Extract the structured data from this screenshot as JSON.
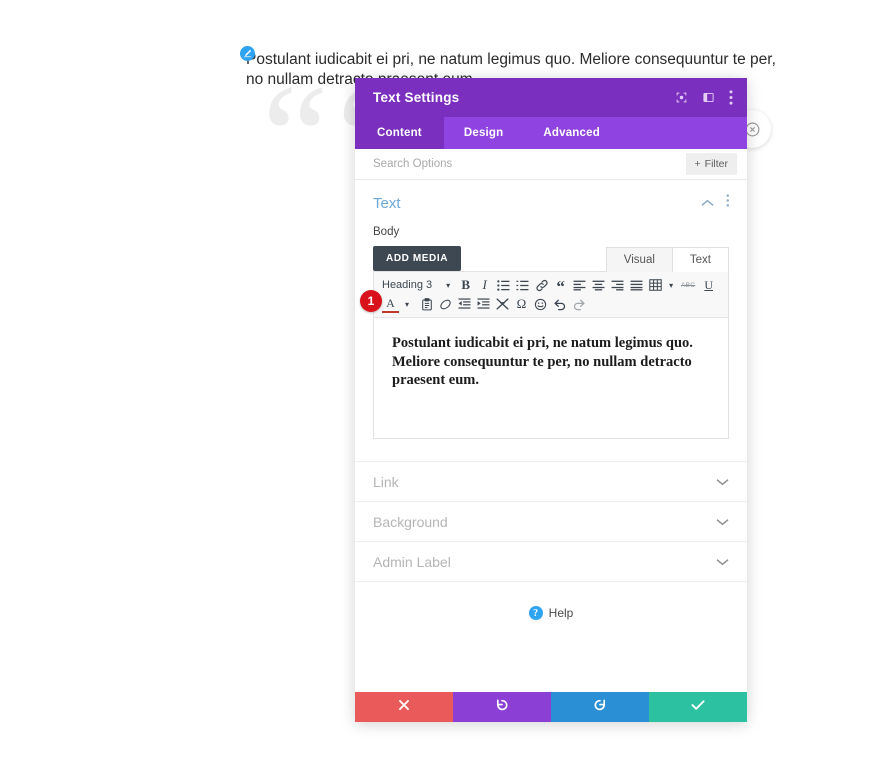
{
  "page": {
    "background_paragraph": "Postulant iudicabit ei pri, ne natum legimus quo. Meliore consequuntur te per, no nullam detracto praesent eum.",
    "quote_marks": "““",
    "edit_badge_icon": "pencil-icon",
    "floating_close_icon": "close-circle-icon"
  },
  "modal": {
    "title": "Text Settings",
    "header_icons": [
      {
        "name": "expand-icon",
        "title": "Expand"
      },
      {
        "name": "layout-toggle-icon",
        "title": "Layout"
      },
      {
        "name": "more-options-icon",
        "title": "More"
      }
    ],
    "tabs": [
      {
        "label": "Content",
        "active": true
      },
      {
        "label": "Design",
        "active": false
      },
      {
        "label": "Advanced",
        "active": false
      }
    ],
    "search": {
      "placeholder": "Search Options",
      "value": ""
    },
    "filter_label": "Filter",
    "filter_icon": "plus-icon",
    "section": {
      "title": "Text",
      "collapse_icon": "chevron-up-icon",
      "menu_icon": "more-options-icon",
      "field_label": "Body",
      "add_media_label": "ADD MEDIA",
      "editor_tabs": [
        {
          "label": "Visual",
          "active": true
        },
        {
          "label": "Text",
          "active": false
        }
      ]
    },
    "editor": {
      "format_select": "Heading 3",
      "toolbar_row1": [
        {
          "name": "bold-icon",
          "glyph": "B",
          "style": "bold-serif"
        },
        {
          "name": "italic-icon",
          "glyph": "I",
          "style": "italic-serif"
        },
        {
          "name": "bulleted-list-icon",
          "glyph": "☰",
          "style": "list"
        },
        {
          "name": "numbered-list-icon",
          "glyph": "☰",
          "style": "list"
        },
        {
          "name": "link-icon",
          "glyph": "🔗",
          "style": "icon"
        },
        {
          "name": "blockquote-icon",
          "glyph": "“",
          "style": "quote"
        },
        {
          "name": "align-left-icon",
          "glyph": "≡",
          "style": "align"
        },
        {
          "name": "align-center-icon",
          "glyph": "≡",
          "style": "align"
        },
        {
          "name": "align-right-icon",
          "glyph": "≡",
          "style": "align"
        },
        {
          "name": "align-justify-icon",
          "glyph": "≡",
          "style": "align"
        },
        {
          "name": "table-icon",
          "glyph": "▦",
          "style": "icon"
        },
        {
          "name": "table-caret-icon",
          "glyph": "▾",
          "style": "caret"
        },
        {
          "name": "strikethrough-icon",
          "glyph": "ABC",
          "style": "abc"
        },
        {
          "name": "underline-icon",
          "glyph": "U",
          "style": "underline"
        }
      ],
      "toolbar_row2": [
        {
          "name": "text-color-icon",
          "glyph": "A",
          "style": "colorA"
        },
        {
          "name": "text-color-caret-icon",
          "glyph": "▾",
          "style": "caret"
        },
        {
          "name": "paste-as-text-icon",
          "glyph": "📋",
          "style": "icon"
        },
        {
          "name": "clear-formatting-icon",
          "glyph": "⊘",
          "style": "icon"
        },
        {
          "name": "decrease-indent-icon",
          "glyph": "⇤",
          "style": "icon"
        },
        {
          "name": "increase-indent-icon",
          "glyph": "⇥",
          "style": "icon"
        },
        {
          "name": "special-character-icon",
          "glyph": "✂",
          "style": "icon"
        },
        {
          "name": "omega-icon",
          "glyph": "Ω",
          "style": "icon"
        },
        {
          "name": "emoji-icon",
          "glyph": "☺",
          "style": "icon"
        },
        {
          "name": "undo-icon",
          "glyph": "↺",
          "style": "icon"
        },
        {
          "name": "redo-icon",
          "glyph": "↻",
          "style": "icon"
        }
      ],
      "content": "Postulant iudicabit ei pri, ne natum legimus quo. Meliore consequuntur te per, no nullam detracto praesent eum."
    },
    "accordions": [
      {
        "label": "Link",
        "chevron": "chevron-down-icon"
      },
      {
        "label": "Background",
        "chevron": "chevron-down-icon"
      },
      {
        "label": "Admin Label",
        "chevron": "chevron-down-icon"
      }
    ],
    "help": {
      "label": "Help",
      "icon": "question-mark-icon",
      "badge_char": "?"
    },
    "footer_buttons": [
      {
        "name": "cancel-button",
        "icon": "close-x-icon",
        "color": "#eb5a5a"
      },
      {
        "name": "undo-button",
        "icon": "undo-arrow-icon",
        "color": "#8B3FD4"
      },
      {
        "name": "redo-button",
        "icon": "redo-arrow-icon",
        "color": "#2a8fd4"
      },
      {
        "name": "save-button",
        "icon": "checkmark-icon",
        "color": "#2CC1A0"
      }
    ]
  },
  "annotation": {
    "step_number": "1"
  },
  "colors": {
    "header_purple": "#7B2FBF",
    "tabs_purple": "#8F43E0",
    "accent_blue": "#2ea3f2",
    "badge_red": "#d9111b"
  }
}
